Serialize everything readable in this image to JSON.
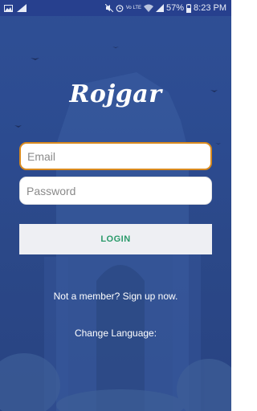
{
  "status_bar": {
    "network_label": "Vo LTE",
    "battery": "57%",
    "time": "8:23 PM"
  },
  "app": {
    "logo_text": "Rojgar"
  },
  "login_form": {
    "email_placeholder": "Email",
    "password_placeholder": "Password",
    "login_label": "LOGIN"
  },
  "links": {
    "signup": "Not a member? Sign up now.",
    "change_language": "Change Language:"
  },
  "colors": {
    "background": "#2c4b90",
    "status_bar": "#27408e",
    "focus_border": "#d98a1e",
    "login_text": "#2a9a6a"
  }
}
